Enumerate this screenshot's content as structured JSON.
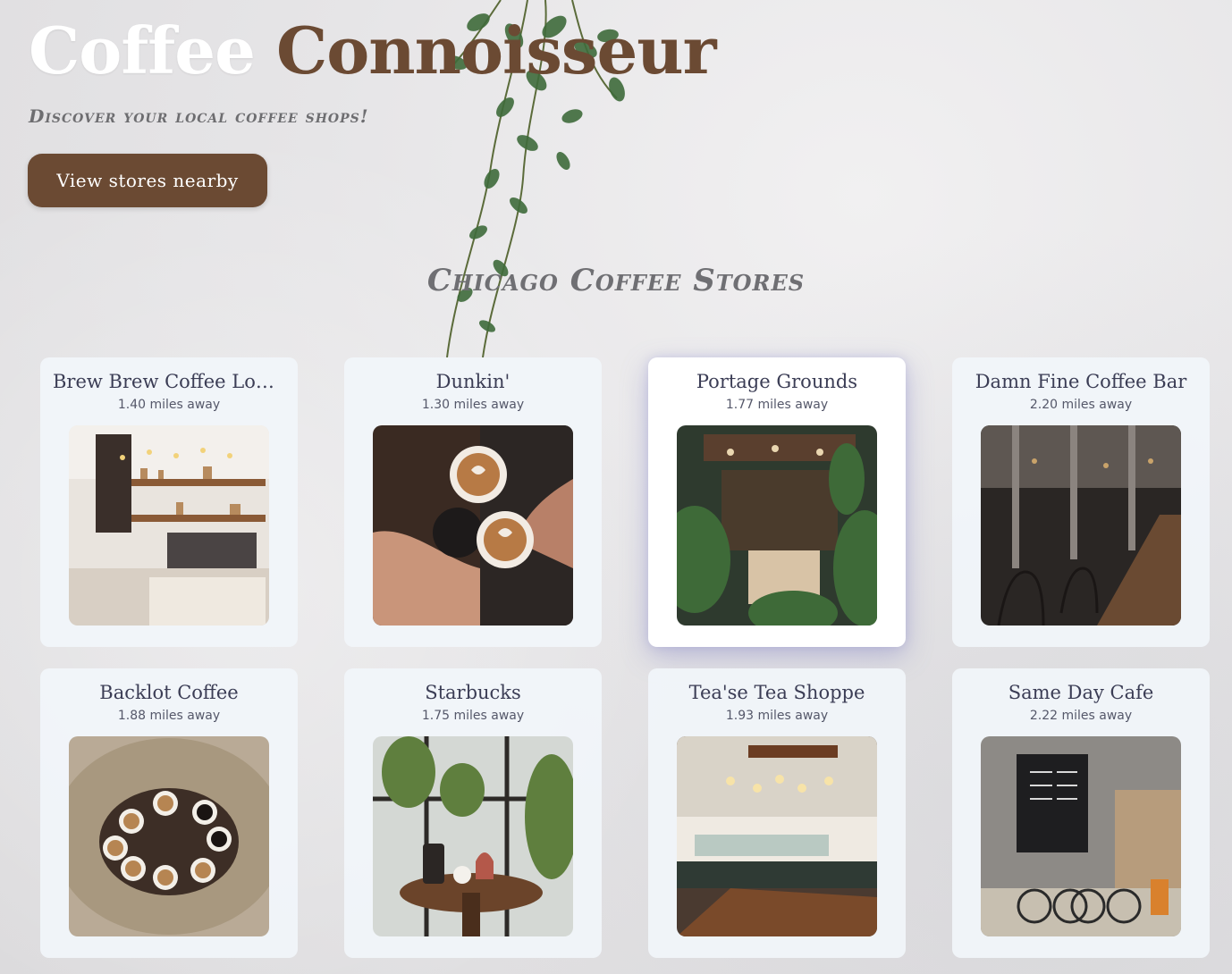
{
  "hero": {
    "title_word1": "Coffee",
    "title_word2": "Connoisseur",
    "tagline": "Discover your local coffee shops!",
    "cta_label": "View stores nearby"
  },
  "section": {
    "title": "Chicago Coffee Stores"
  },
  "stores": [
    {
      "name": "Brew Brew Coffee Lou...",
      "distance": "1.40 miles away",
      "photo": "coffee-bar-interior"
    },
    {
      "name": "Dunkin'",
      "distance": "1.30 miles away",
      "photo": "latte-cups-toast"
    },
    {
      "name": "Portage Grounds",
      "distance": "1.77 miles away",
      "photo": "plant-filled-cafe"
    },
    {
      "name": "Damn Fine Coffee Bar",
      "distance": "2.20 miles away",
      "photo": "industrial-cafe-counter"
    },
    {
      "name": "Backlot Coffee",
      "distance": "1.88 miles away",
      "photo": "coffee-cups-table-top"
    },
    {
      "name": "Starbucks",
      "distance": "1.75 miles away",
      "photo": "window-table-french-press"
    },
    {
      "name": "Tea'se Tea Shoppe",
      "distance": "1.93 miles away",
      "photo": "cafe-counter-pendant-lights"
    },
    {
      "name": "Same Day Cafe",
      "distance": "2.22 miles away",
      "photo": "concrete-cafe-bicycles"
    }
  ],
  "colors": {
    "brand_brown": "#6b4a33",
    "card_bg": "#f1f5f9",
    "heading_gray": "#6f6f73"
  }
}
